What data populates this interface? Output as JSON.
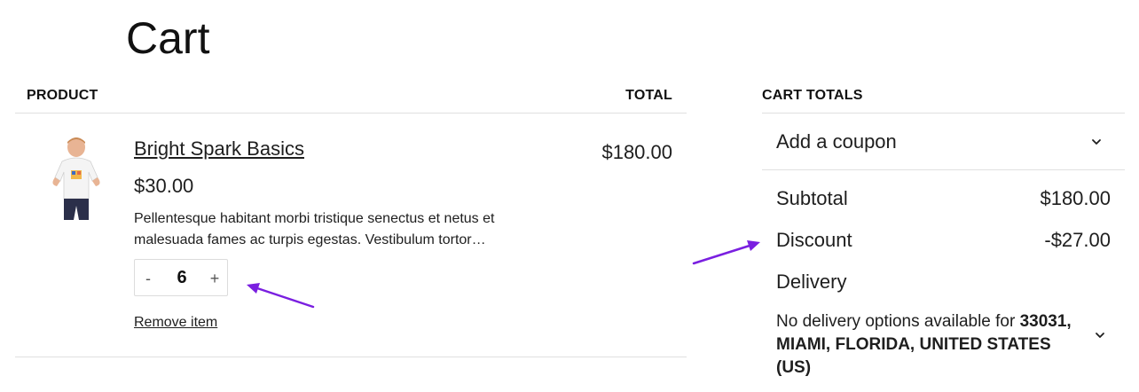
{
  "page": {
    "title": "Cart"
  },
  "table": {
    "product_header": "PRODUCT",
    "total_header": "TOTAL"
  },
  "item": {
    "name": "Bright Spark Basics",
    "price": "$30.00",
    "description": "Pellentesque habitant morbi tristique senectus et netus et malesuada fames ac turpis egestas. Vestibulum tortor…",
    "quantity": "6",
    "qty_minus": "-",
    "qty_plus": "+",
    "remove_label": "Remove item",
    "line_total": "$180.00"
  },
  "totals": {
    "header": "CART TOTALS",
    "coupon_label": "Add a coupon",
    "subtotal_label": "Subtotal",
    "subtotal_value": "$180.00",
    "discount_label": "Discount",
    "discount_value": "-$27.00",
    "delivery_label": "Delivery",
    "delivery_prefix": "No delivery options available for ",
    "delivery_location": "33031, MIAMI, FLORIDA, UNITED STATES (US)"
  },
  "colors": {
    "annotation_arrow": "#7a1fe0",
    "divider": "#e0e0e0",
    "text": "#1e1e1e"
  },
  "icons": {
    "coupon_toggle": "chevron-down-icon",
    "delivery_toggle": "chevron-down-icon"
  }
}
